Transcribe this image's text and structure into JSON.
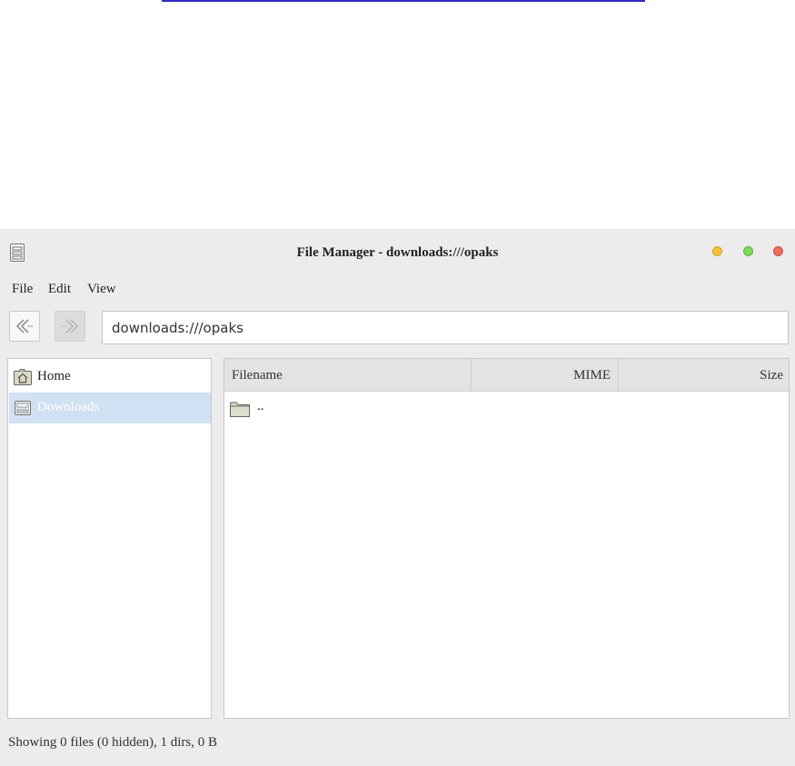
{
  "window": {
    "title": "File Manager - downloads:///opaks"
  },
  "menu": {
    "file": "File",
    "edit": "Edit",
    "view": "View"
  },
  "toolbar": {
    "address_value": "downloads:///opaks"
  },
  "sidebar": {
    "items": [
      {
        "label": "Home",
        "icon": "home-folder-icon",
        "selected": false
      },
      {
        "label": "Downloads",
        "icon": "downloads-drive-icon",
        "selected": true
      }
    ]
  },
  "table": {
    "columns": [
      "Filename",
      "MIME",
      "Size"
    ],
    "rows": [
      {
        "name": "..",
        "icon": "folder-icon",
        "mime": "",
        "size": ""
      }
    ]
  },
  "status": {
    "text": "Showing 0 files (0 hidden), 1 dirs, 0 B"
  },
  "colors": {
    "selection": "#cfe1f3",
    "minimize": "#f5c13a",
    "maximize": "#7ed957",
    "close": "#f06a5d"
  }
}
